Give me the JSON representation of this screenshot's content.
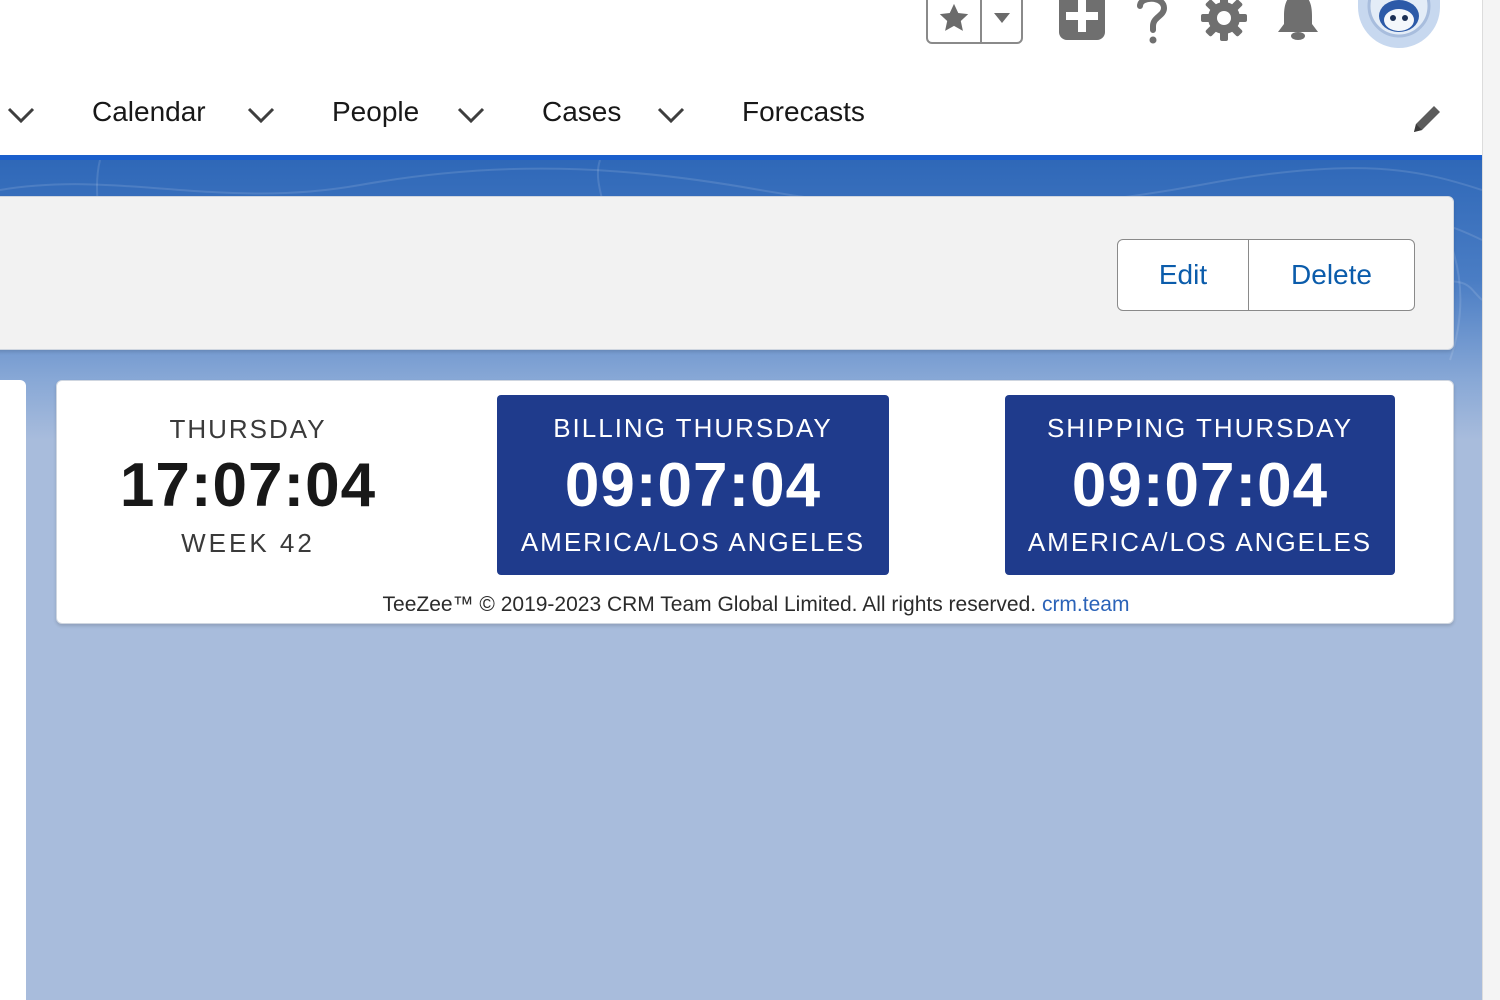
{
  "header": {
    "favorites_icon": "star-icon",
    "favorites_menu_icon": "caret-down-icon",
    "icons": [
      "add-icon",
      "help-icon",
      "gear-icon",
      "bell-icon"
    ],
    "avatar": "user-avatar"
  },
  "nav": {
    "items": [
      {
        "label": "Calendar",
        "has_menu": true
      },
      {
        "label": "People",
        "has_menu": true
      },
      {
        "label": "Cases",
        "has_menu": true
      },
      {
        "label": "Forecasts",
        "has_menu": false
      }
    ]
  },
  "record": {
    "edit_label": "Edit",
    "delete_label": "Delete"
  },
  "clock": {
    "local": {
      "day": "THURSDAY",
      "time": "17:07:04",
      "week": "WEEK 42"
    },
    "zones": [
      {
        "title": "BILLING THURSDAY",
        "time": "09:07:04",
        "zone": "AMERICA/LOS ANGELES"
      },
      {
        "title": "SHIPPING THURSDAY",
        "time": "09:07:04",
        "zone": "AMERICA/LOS ANGELES"
      }
    ],
    "footer_text": "TeeZee™ © 2019-2023 CRM Team Global Limited.  All rights reserved.",
    "footer_link": "crm.team"
  },
  "colors": {
    "brand_blue": "#1b5fcc",
    "tile_blue": "#1f3b8c",
    "link_blue": "#0b5cab",
    "page_background": "#a8bcdc"
  }
}
